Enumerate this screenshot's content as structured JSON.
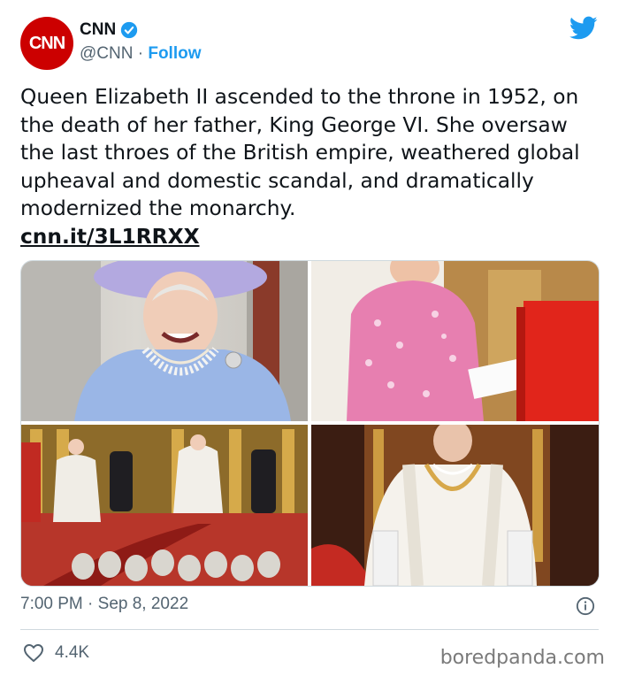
{
  "account": {
    "avatar_text": "CNN",
    "name": "CNN",
    "handle": "@CNN",
    "separator": "·",
    "follow_label": "Follow"
  },
  "tweet": {
    "text": "Queen Elizabeth II ascended to the throne in 1952, on the death of her father, King George VI. She oversaw the last throes of the British empire, weathered global upheaval and domestic scandal, and dramatically modernized the monarchy.",
    "link": "cnn.it/3L1RRXX"
  },
  "meta": {
    "time": "7:00 PM",
    "separator": "·",
    "date": "Sep 8, 2022"
  },
  "stats": {
    "likes": "4.4K"
  },
  "watermark": "boredpanda.com",
  "colors": {
    "brand_red": "#cc0000",
    "twitter_blue": "#1d9bf0",
    "secondary_text": "#536471"
  }
}
